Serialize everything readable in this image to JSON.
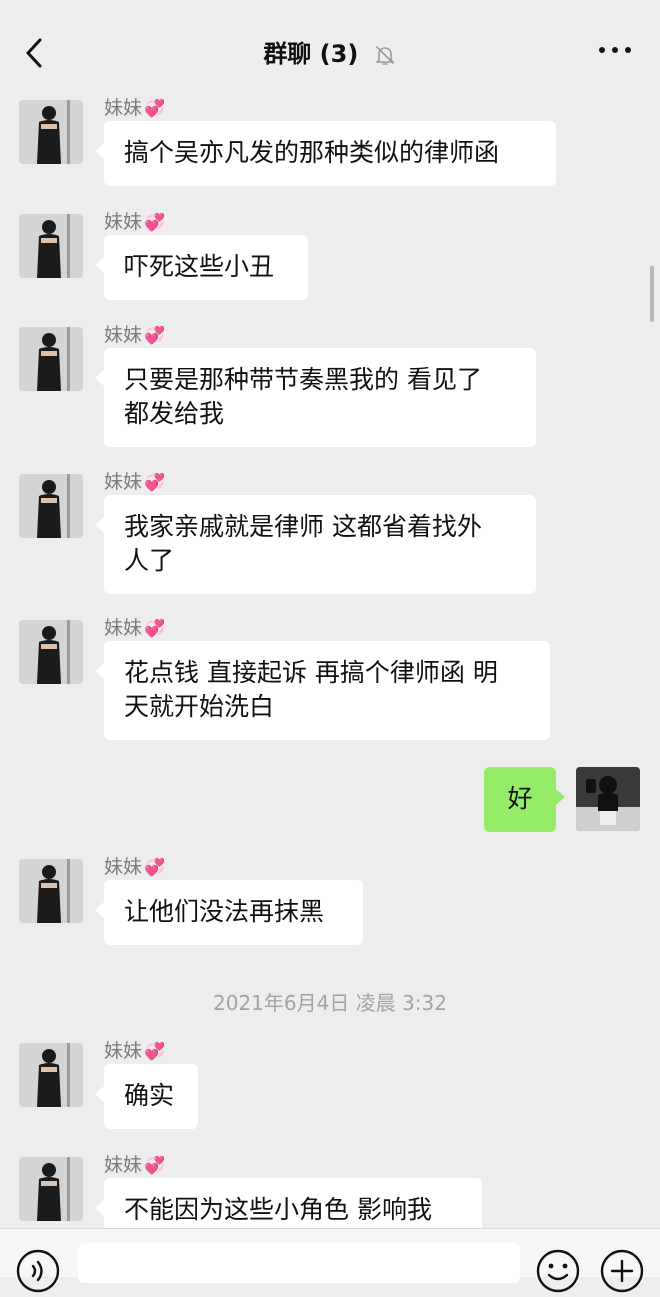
{
  "header": {
    "title": "群聊 (3)",
    "back_icon": "chevron-left-icon",
    "mute_icon": "bell-off-icon",
    "more_icon": "ellipsis-icon"
  },
  "messages": [
    {
      "sender": "妹妹",
      "heart": "💞",
      "lines": [
        "搞个吴亦凡发的那种类似的律师函"
      ]
    },
    {
      "sender": "妹妹",
      "heart": "💞",
      "lines": [
        "吓死这些小丑"
      ]
    },
    {
      "sender": "妹妹",
      "heart": "💞",
      "lines": [
        "只要是那种带节奏黑我的 看见了",
        "都发给我"
      ]
    },
    {
      "sender": "妹妹",
      "heart": "💞",
      "lines": [
        "我家亲戚就是律师 这都省着找外",
        "人了"
      ]
    },
    {
      "sender": "妹妹",
      "heart": "💞",
      "lines": [
        "花点钱 直接起诉 再搞个律师函 明",
        "天就开始洗白"
      ]
    },
    {
      "sender": "me",
      "lines": [
        "好"
      ]
    },
    {
      "sender": "妹妹",
      "heart": "💞",
      "lines": [
        "让他们没法再抹黑"
      ]
    },
    {
      "sender": "妹妹",
      "heart": "💞",
      "lines": [
        "确实"
      ]
    },
    {
      "sender": "妹妹",
      "heart": "💞",
      "lines": [
        "不能因为这些小角色 影响我"
      ]
    }
  ],
  "timestamp": "2021年6月4日 凌晨 3:32",
  "input_bar": {
    "voice_icon": "voice-icon",
    "emoji_icon": "emoji-icon",
    "plus_icon": "plus-icon",
    "input_value": ""
  },
  "colors": {
    "background": "#ededed",
    "bubble_other": "#ffffff",
    "bubble_me": "#95ec69",
    "sender_name": "#7b7b7b",
    "timestamp": "#a3a3a3"
  }
}
